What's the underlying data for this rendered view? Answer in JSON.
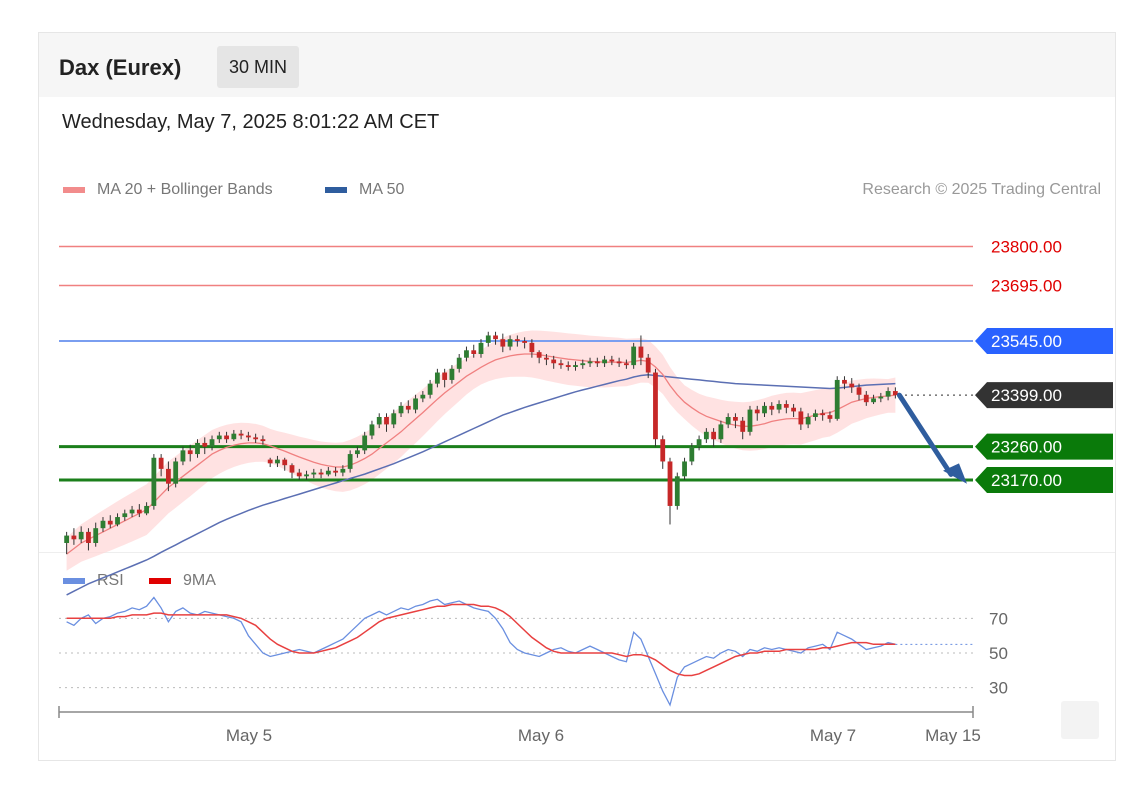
{
  "header": {
    "title": "Dax (Eurex)",
    "timeframe": "30 MIN"
  },
  "date_label": "Wednesday, May 7, 2025 8:01:22 AM CET",
  "legend": {
    "ma20": "MA 20 + Bollinger Bands",
    "ma50": "MA 50",
    "research": "Research © 2025 Trading Central"
  },
  "rsi_legend": {
    "rsi": "RSI",
    "ma": "9MA"
  },
  "colors": {
    "bull": "#2e7d32",
    "bear": "#c62828",
    "resistance": "#f08080",
    "ma50": "#5b6fb3",
    "support": "#1b7f1b",
    "current": "#333333",
    "pivot": "#2962ff",
    "band": "#ffd6d6"
  },
  "chart_data": {
    "type": "candlestick",
    "ylim": [
      23000,
      23850
    ],
    "levels": [
      {
        "value": 23800,
        "label": "23800.00",
        "kind": "resistance"
      },
      {
        "value": 23695,
        "label": "23695.00",
        "kind": "resistance"
      },
      {
        "value": 23545,
        "label": "23545.00",
        "kind": "pivot"
      },
      {
        "value": 23399,
        "label": "23399.00",
        "kind": "current"
      },
      {
        "value": 23260,
        "label": "23260.00",
        "kind": "support"
      },
      {
        "value": 23170,
        "label": "23170.00",
        "kind": "support"
      }
    ],
    "xticks": [
      "May 5",
      "May 6",
      "May 7",
      "May 15"
    ],
    "candles": [
      [
        23000,
        23020,
        22970,
        23030
      ],
      [
        23020,
        23010,
        22995,
        23040
      ],
      [
        23010,
        23030,
        23000,
        23045
      ],
      [
        23030,
        23000,
        22980,
        23040
      ],
      [
        23000,
        23040,
        22990,
        23055
      ],
      [
        23040,
        23060,
        23030,
        23070
      ],
      [
        23060,
        23050,
        23040,
        23075
      ],
      [
        23050,
        23070,
        23045,
        23080
      ],
      [
        23070,
        23080,
        23060,
        23090
      ],
      [
        23080,
        23090,
        23070,
        23100
      ],
      [
        23090,
        23080,
        23070,
        23105
      ],
      [
        23080,
        23100,
        23075,
        23110
      ],
      [
        23100,
        23230,
        23090,
        23240
      ],
      [
        23230,
        23200,
        23180,
        23240
      ],
      [
        23200,
        23160,
        23140,
        23220
      ],
      [
        23160,
        23220,
        23150,
        23230
      ],
      [
        23220,
        23250,
        23210,
        23260
      ],
      [
        23250,
        23240,
        23220,
        23265
      ],
      [
        23240,
        23270,
        23230,
        23280
      ],
      [
        23270,
        23260,
        23240,
        23285
      ],
      [
        23260,
        23280,
        23250,
        23290
      ],
      [
        23280,
        23290,
        23270,
        23300
      ],
      [
        23290,
        23280,
        23270,
        23300
      ],
      [
        23280,
        23295,
        23275,
        23305
      ],
      [
        23295,
        23290,
        23280,
        23305
      ],
      [
        23290,
        23285,
        23275,
        23300
      ],
      [
        23285,
        23280,
        23270,
        23295
      ],
      [
        23280,
        23275,
        23265,
        23290
      ],
      [
        23225,
        23215,
        23205,
        23230
      ],
      [
        23215,
        23225,
        23205,
        23235
      ],
      [
        23225,
        23210,
        23195,
        23230
      ],
      [
        23210,
        23190,
        23175,
        23215
      ],
      [
        23190,
        23180,
        23170,
        23200
      ],
      [
        23180,
        23185,
        23170,
        23195
      ],
      [
        23185,
        23190,
        23175,
        23200
      ],
      [
        23190,
        23185,
        23175,
        23200
      ],
      [
        23185,
        23195,
        23180,
        23205
      ],
      [
        23195,
        23190,
        23180,
        23205
      ],
      [
        23190,
        23200,
        23180,
        23210
      ],
      [
        23200,
        23240,
        23190,
        23250
      ],
      [
        23240,
        23250,
        23230,
        23260
      ],
      [
        23250,
        23290,
        23240,
        23300
      ],
      [
        23290,
        23320,
        23280,
        23330
      ],
      [
        23320,
        23340,
        23310,
        23350
      ],
      [
        23340,
        23320,
        23300,
        23350
      ],
      [
        23320,
        23350,
        23310,
        23360
      ],
      [
        23350,
        23370,
        23340,
        23380
      ],
      [
        23370,
        23360,
        23350,
        23385
      ],
      [
        23360,
        23390,
        23350,
        23400
      ],
      [
        23390,
        23400,
        23380,
        23410
      ],
      [
        23400,
        23430,
        23390,
        23440
      ],
      [
        23430,
        23460,
        23420,
        23470
      ],
      [
        23460,
        23440,
        23420,
        23470
      ],
      [
        23440,
        23470,
        23430,
        23480
      ],
      [
        23470,
        23500,
        23460,
        23510
      ],
      [
        23500,
        23520,
        23490,
        23530
      ],
      [
        23520,
        23510,
        23500,
        23535
      ],
      [
        23510,
        23540,
        23500,
        23550
      ],
      [
        23540,
        23560,
        23530,
        23570
      ],
      [
        23560,
        23550,
        23535,
        23570
      ],
      [
        23550,
        23530,
        23515,
        23565
      ],
      [
        23530,
        23550,
        23520,
        23560
      ],
      [
        23550,
        23545,
        23530,
        23560
      ],
      [
        23545,
        23540,
        23525,
        23555
      ],
      [
        23540,
        23515,
        23500,
        23550
      ],
      [
        23515,
        23500,
        23485,
        23520
      ],
      [
        23500,
        23495,
        23480,
        23510
      ],
      [
        23495,
        23485,
        23470,
        23505
      ],
      [
        23485,
        23480,
        23470,
        23495
      ],
      [
        23480,
        23475,
        23465,
        23490
      ],
      [
        23475,
        23480,
        23465,
        23490
      ],
      [
        23480,
        23485,
        23470,
        23495
      ],
      [
        23485,
        23490,
        23475,
        23500
      ],
      [
        23490,
        23485,
        23475,
        23500
      ],
      [
        23485,
        23495,
        23475,
        23505
      ],
      [
        23495,
        23490,
        23480,
        23505
      ],
      [
        23490,
        23485,
        23475,
        23500
      ],
      [
        23485,
        23480,
        23470,
        23495
      ],
      [
        23480,
        23530,
        23470,
        23540
      ],
      [
        23530,
        23500,
        23480,
        23560
      ],
      [
        23500,
        23460,
        23445,
        23510
      ],
      [
        23460,
        23280,
        23260,
        23470
      ],
      [
        23280,
        23220,
        23200,
        23290
      ],
      [
        23220,
        23100,
        23050,
        23230
      ],
      [
        23100,
        23180,
        23090,
        23190
      ],
      [
        23180,
        23220,
        23170,
        23230
      ],
      [
        23220,
        23260,
        23210,
        23270
      ],
      [
        23260,
        23280,
        23250,
        23290
      ],
      [
        23280,
        23300,
        23270,
        23310
      ],
      [
        23300,
        23280,
        23260,
        23310
      ],
      [
        23280,
        23320,
        23270,
        23330
      ],
      [
        23320,
        23340,
        23310,
        23350
      ],
      [
        23340,
        23330,
        23310,
        23350
      ],
      [
        23330,
        23300,
        23280,
        23340
      ],
      [
        23300,
        23360,
        23290,
        23370
      ],
      [
        23360,
        23350,
        23330,
        23370
      ],
      [
        23350,
        23370,
        23340,
        23380
      ],
      [
        23370,
        23360,
        23345,
        23380
      ],
      [
        23360,
        23375,
        23350,
        23385
      ],
      [
        23375,
        23365,
        23350,
        23385
      ],
      [
        23365,
        23355,
        23340,
        23375
      ],
      [
        23355,
        23320,
        23305,
        23365
      ],
      [
        23320,
        23340,
        23310,
        23350
      ],
      [
        23340,
        23350,
        23330,
        23360
      ],
      [
        23350,
        23345,
        23330,
        23360
      ],
      [
        23345,
        23335,
        23325,
        23355
      ],
      [
        23335,
        23440,
        23330,
        23450
      ],
      [
        23440,
        23430,
        23415,
        23450
      ],
      [
        23430,
        23420,
        23405,
        23445
      ],
      [
        23420,
        23400,
        23385,
        23430
      ],
      [
        23400,
        23380,
        23370,
        23410
      ],
      [
        23380,
        23390,
        23375,
        23400
      ],
      [
        23390,
        23395,
        23380,
        23405
      ],
      [
        23395,
        23410,
        23385,
        23420
      ],
      [
        23410,
        23399,
        23390,
        23420
      ]
    ],
    "ma20": [
      22970,
      22985,
      23000,
      23010,
      23020,
      23030,
      23040,
      23050,
      23060,
      23070,
      23080,
      23090,
      23110,
      23130,
      23150,
      23165,
      23180,
      23195,
      23210,
      23225,
      23240,
      23250,
      23258,
      23264,
      23268,
      23270,
      23270,
      23268,
      23262,
      23255,
      23248,
      23240,
      23232,
      23225,
      23218,
      23212,
      23208,
      23205,
      23205,
      23210,
      23218,
      23228,
      23240,
      23255,
      23270,
      23285,
      23300,
      23318,
      23335,
      23352,
      23370,
      23388,
      23405,
      23420,
      23435,
      23450,
      23462,
      23474,
      23485,
      23494,
      23500,
      23505,
      23508,
      23510,
      23510,
      23508,
      23505,
      23502,
      23499,
      23496,
      23494,
      23492,
      23490,
      23489,
      23488,
      23488,
      23488,
      23487,
      23490,
      23493,
      23490,
      23475,
      23455,
      23425,
      23400,
      23380,
      23365,
      23352,
      23342,
      23335,
      23328,
      23322,
      23318,
      23315,
      23315,
      23318,
      23322,
      23328,
      23332,
      23335,
      23336,
      23335,
      23340,
      23345,
      23350,
      23352,
      23360,
      23370,
      23380,
      23385,
      23390,
      23393,
      23395,
      23397,
      23399
    ],
    "ma50": [
      22860,
      22870,
      22880,
      22890,
      22898,
      22906,
      22914,
      22922,
      22930,
      22938,
      22946,
      22954,
      22964,
      22975,
      22985,
      22995,
      23005,
      23015,
      23025,
      23035,
      23045,
      23055,
      23064,
      23072,
      23080,
      23088,
      23095,
      23102,
      23108,
      23114,
      23120,
      23126,
      23132,
      23138,
      23144,
      23150,
      23156,
      23162,
      23168,
      23174,
      23180,
      23186,
      23193,
      23200,
      23207,
      23214,
      23222,
      23230,
      23238,
      23246,
      23255,
      23264,
      23273,
      23282,
      23291,
      23300,
      23309,
      23318,
      23327,
      23336,
      23345,
      23352,
      23359,
      23366,
      23372,
      23378,
      23384,
      23390,
      23396,
      23402,
      23408,
      23413,
      23418,
      23423,
      23428,
      23433,
      23438,
      23442,
      23448,
      23452,
      23454,
      23452,
      23450,
      23448,
      23446,
      23444,
      23442,
      23440,
      23438,
      23436,
      23434,
      23432,
      23430,
      23429,
      23428,
      23427,
      23426,
      23425,
      23424,
      23423,
      23422,
      23421,
      23420,
      23419,
      23418,
      23417,
      23418,
      23420,
      23422,
      23424,
      23426,
      23427,
      23428,
      23429,
      23430
    ],
    "rsi": [
      68,
      66,
      70,
      72,
      67,
      70,
      71,
      73,
      74,
      76,
      75,
      77,
      82,
      76,
      68,
      74,
      76,
      73,
      72,
      74,
      73,
      72,
      71,
      70,
      68,
      60,
      55,
      50,
      48,
      49,
      50,
      51,
      52,
      51,
      50,
      52,
      54,
      56,
      58,
      62,
      66,
      70,
      72,
      74,
      72,
      74,
      76,
      75,
      77,
      78,
      80,
      81,
      78,
      79,
      80,
      78,
      76,
      75,
      74,
      70,
      64,
      56,
      52,
      50,
      49,
      48,
      50,
      52,
      53,
      51,
      50,
      52,
      54,
      52,
      50,
      48,
      46,
      45,
      62,
      58,
      48,
      38,
      28,
      20,
      36,
      42,
      44,
      46,
      48,
      47,
      50,
      52,
      51,
      48,
      52,
      51,
      53,
      52,
      53,
      52,
      51,
      50,
      53,
      54,
      55,
      52,
      62,
      60,
      58,
      55,
      52,
      53,
      54,
      56,
      55
    ],
    "rsi_ma": [
      70,
      70,
      70,
      70,
      70,
      70,
      70,
      71,
      71,
      72,
      72,
      72,
      73,
      73,
      72,
      72,
      72,
      72,
      72,
      72,
      72,
      72,
      72,
      71,
      70,
      68,
      66,
      62,
      58,
      55,
      53,
      51,
      50,
      50,
      50,
      51,
      52,
      53,
      55,
      57,
      59,
      62,
      65,
      68,
      70,
      71,
      72,
      73,
      74,
      75,
      76,
      77,
      77,
      78,
      78,
      78,
      78,
      77,
      77,
      76,
      74,
      71,
      67,
      63,
      59,
      56,
      53,
      51,
      50,
      50,
      50,
      50,
      50,
      50,
      50,
      50,
      49,
      48,
      49,
      49,
      48,
      46,
      43,
      40,
      38,
      37,
      37,
      38,
      40,
      42,
      44,
      46,
      48,
      49,
      50,
      50,
      51,
      51,
      51,
      52,
      52,
      52,
      52,
      52,
      53,
      53,
      54,
      55,
      56,
      56,
      56,
      55,
      55,
      55,
      55
    ],
    "rsi_levels": [
      {
        "value": 70,
        "label": "70"
      },
      {
        "value": 50,
        "label": "50"
      },
      {
        "value": 30,
        "label": "30"
      }
    ]
  }
}
